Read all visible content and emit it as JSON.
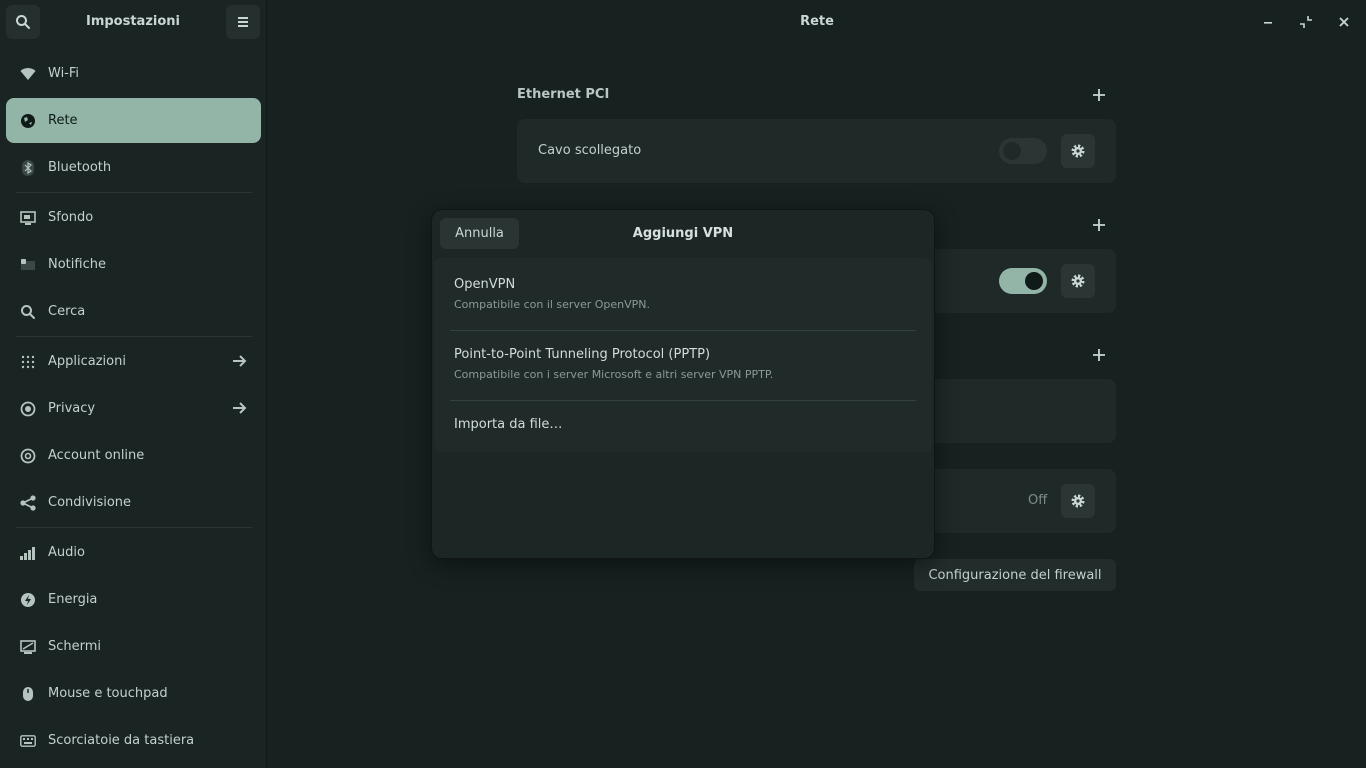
{
  "sidebar": {
    "title": "Impostazioni",
    "items": [
      {
        "label": "Wi-Fi",
        "icon": "wifi-icon"
      },
      {
        "label": "Rete",
        "icon": "network-icon",
        "active": true
      },
      {
        "label": "Bluetooth",
        "icon": "bluetooth-icon"
      },
      {
        "label": "Sfondo",
        "icon": "background-icon"
      },
      {
        "label": "Notifiche",
        "icon": "notifications-icon"
      },
      {
        "label": "Cerca",
        "icon": "search-icon"
      },
      {
        "label": "Applicazioni",
        "icon": "apps-icon"
      },
      {
        "label": "Privacy",
        "icon": "privacy-icon"
      },
      {
        "label": "Account online",
        "icon": "online-accounts-icon"
      },
      {
        "label": "Condivisione",
        "icon": "share-icon"
      },
      {
        "label": "Audio",
        "icon": "audio-icon"
      },
      {
        "label": "Energia",
        "icon": "power-icon"
      },
      {
        "label": "Schermi",
        "icon": "displays-icon"
      },
      {
        "label": "Mouse e touchpad",
        "icon": "mouse-icon"
      },
      {
        "label": "Scorciatoie da tastiera",
        "icon": "keyboard-icon"
      }
    ]
  },
  "header": {
    "title": "Rete"
  },
  "main": {
    "ethernet": {
      "title": "Ethernet PCI",
      "status": "Cavo scollegato"
    },
    "proxy": {
      "value": "Off"
    },
    "firewall_button": "Configurazione del firewall"
  },
  "dialog": {
    "title": "Aggiungi VPN",
    "cancel": "Annulla",
    "options": [
      {
        "title": "OpenVPN",
        "subtitle": "Compatibile con il server OpenVPN."
      },
      {
        "title": "Point-to-Point Tunneling Protocol (PPTP)",
        "subtitle": "Compatibile con i server Microsoft e altri server VPN PPTP."
      },
      {
        "title": "Importa da file…"
      }
    ]
  },
  "colors": {
    "background": "#172120",
    "sidebar": "#1a2423",
    "accent": "#93b5a7",
    "card": "#1f2928"
  }
}
